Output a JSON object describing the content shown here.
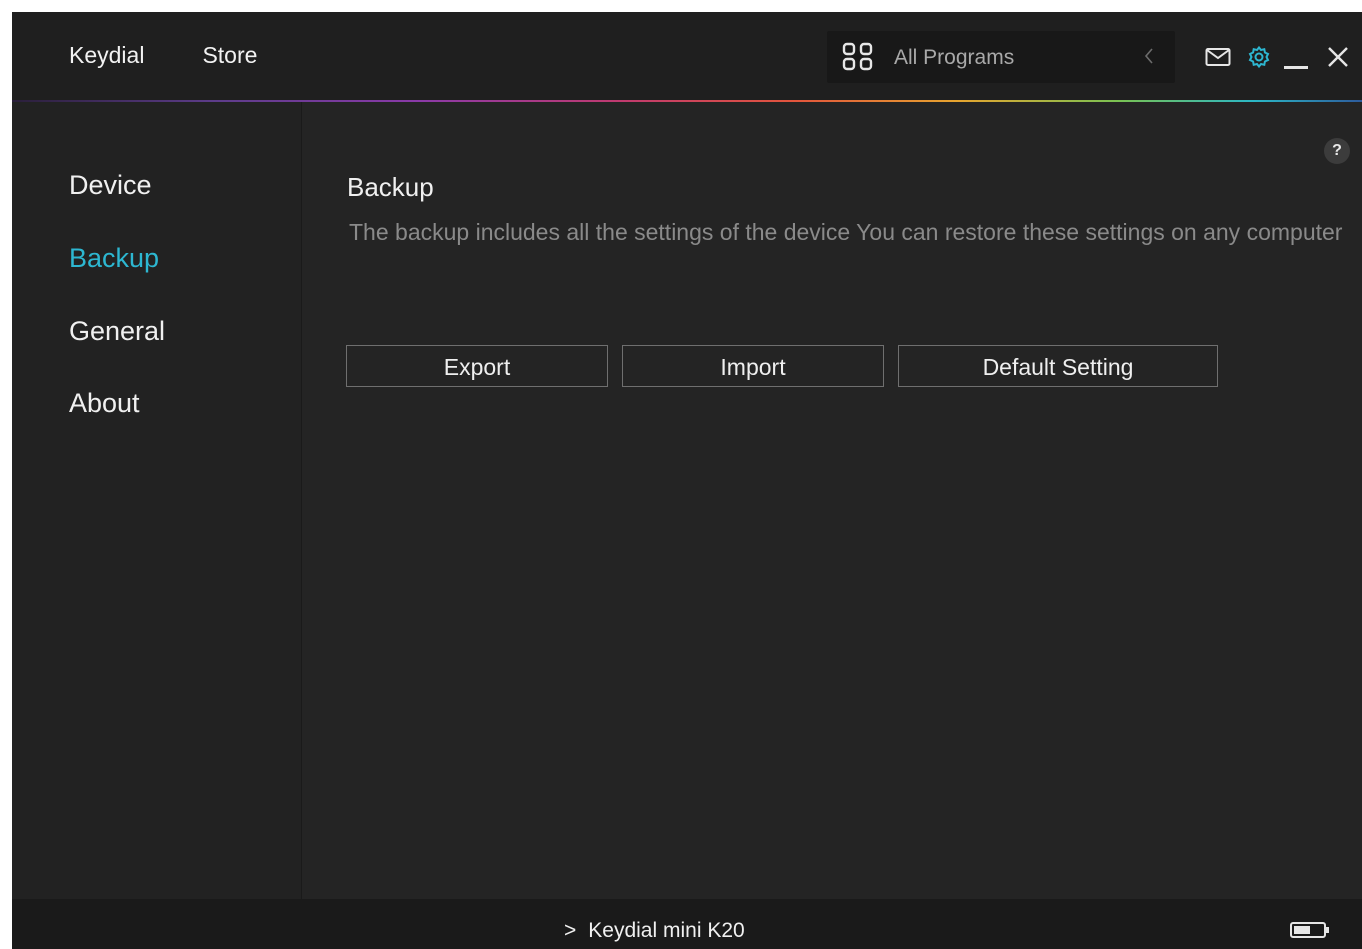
{
  "topbar": {
    "nav": [
      {
        "label": "Keydial"
      },
      {
        "label": "Store"
      }
    ],
    "program_select": {
      "label": "All Programs",
      "icon": "grid-icon"
    },
    "icons": [
      "back-chevron-icon",
      "mail-icon",
      "gear-icon",
      "minimize-icon",
      "close-icon"
    ]
  },
  "sidebar": {
    "items": [
      {
        "label": "Device",
        "active": false
      },
      {
        "label": "Backup",
        "active": true
      },
      {
        "label": "General",
        "active": false
      },
      {
        "label": "About",
        "active": false
      }
    ]
  },
  "main": {
    "help_label": "?",
    "title": "Backup",
    "description": "The backup includes all the settings of the device You can restore these settings  on any computer",
    "buttons": {
      "export": "Export",
      "import": "Import",
      "default": "Default Setting"
    }
  },
  "footer": {
    "device_name": "Keydial mini K20",
    "arrow": ">"
  },
  "colors": {
    "accent": "#2db7d1",
    "background": "#232323",
    "text": "#ececec"
  }
}
